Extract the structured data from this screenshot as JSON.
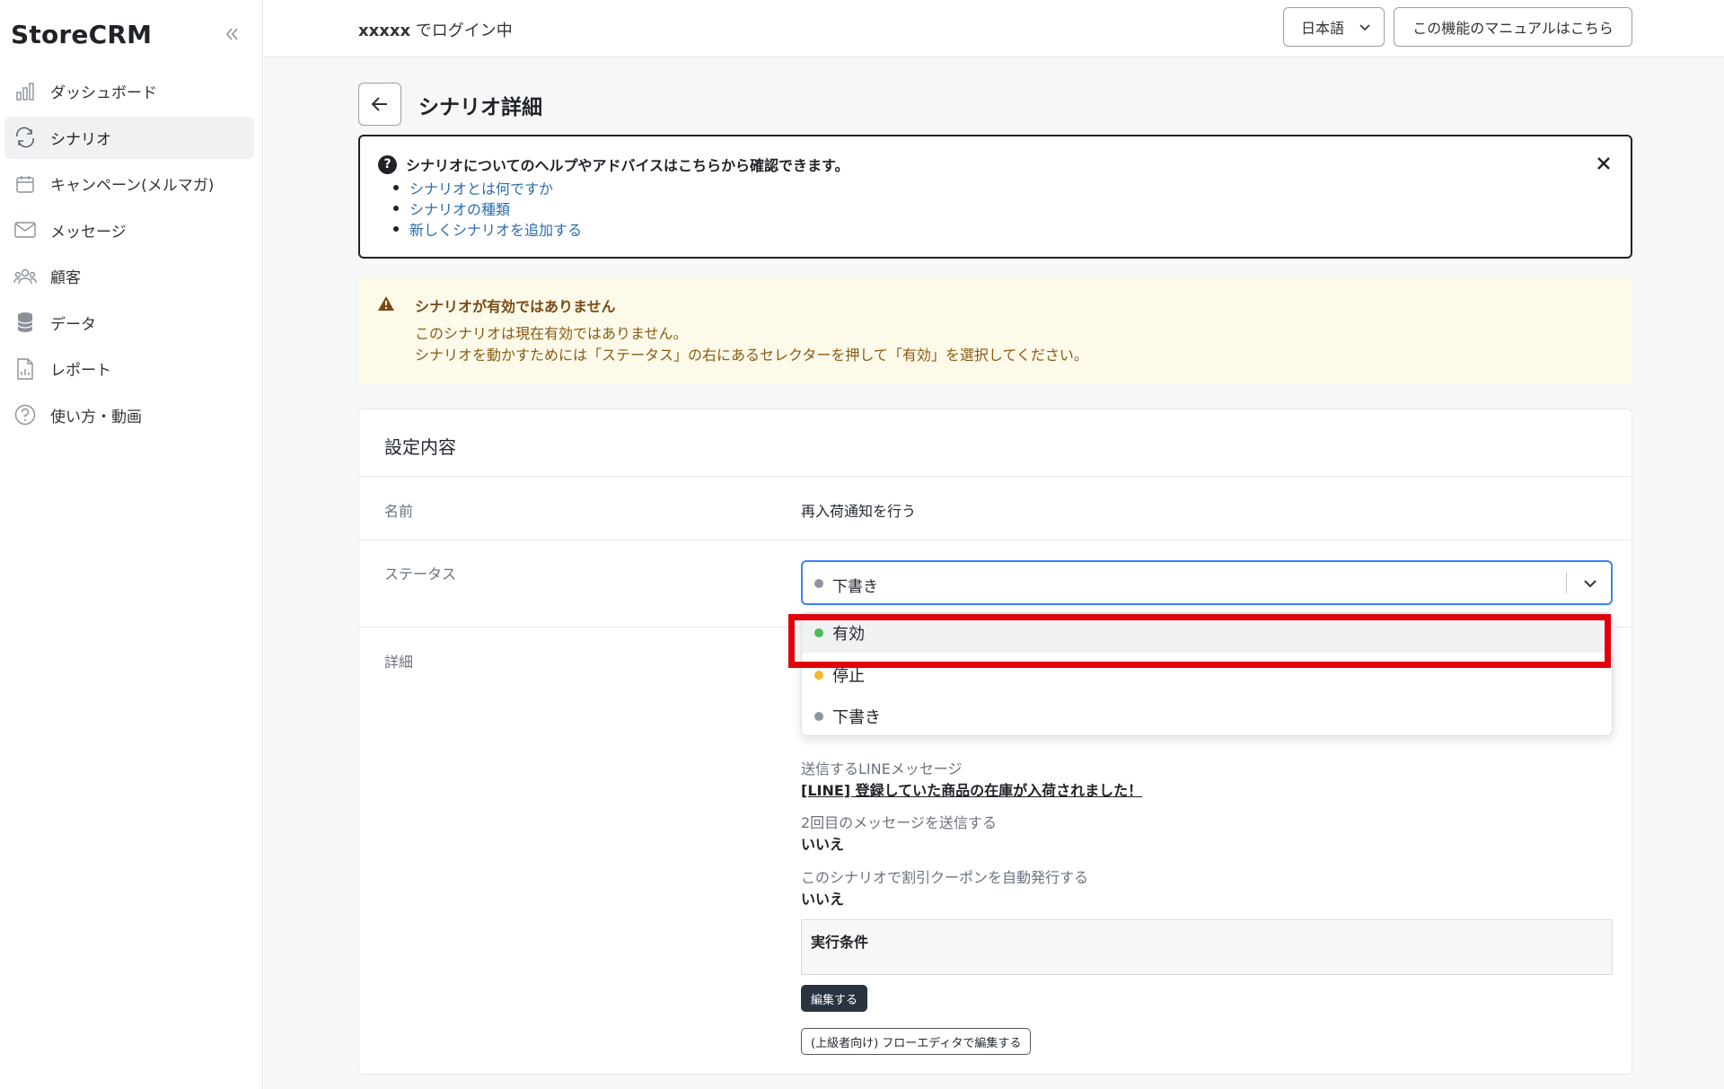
{
  "app": {
    "logo": "StoreCRM"
  },
  "sidebar": {
    "items": [
      {
        "label": "ダッシュボード",
        "icon": "bar-chart-icon"
      },
      {
        "label": "シナリオ",
        "icon": "refresh-icon",
        "active": true
      },
      {
        "label": "キャンペーン(メルマガ)",
        "icon": "calendar-icon"
      },
      {
        "label": "メッセージ",
        "icon": "mail-icon"
      },
      {
        "label": "顧客",
        "icon": "users-icon"
      },
      {
        "label": "データ",
        "icon": "database-icon"
      },
      {
        "label": "レポート",
        "icon": "report-icon"
      },
      {
        "label": "使い方・動画",
        "icon": "help-circle-icon"
      }
    ]
  },
  "header": {
    "login_user": "xxxxx",
    "login_suffix": " でログイン中",
    "language": "日本語",
    "manual_label": "この機能のマニュアルはこちら"
  },
  "page": {
    "title": "シナリオ詳細"
  },
  "help": {
    "title": "シナリオについてのヘルプやアドバイスはこちらから確認できます。",
    "links": [
      "シナリオとは何ですか",
      "シナリオの種類",
      "新しくシナリオを追加する"
    ]
  },
  "warning": {
    "title": "シナリオが有効ではありません",
    "line1": "このシナリオは現在有効ではありません。",
    "line2": "シナリオを動かすためには「ステータス」の右にあるセレクターを押して「有効」を選択してください。"
  },
  "settings": {
    "title": "設定内容",
    "name_label": "名前",
    "name_value": "再入荷通知を行う",
    "status_label": "ステータス",
    "status_value": "下書き",
    "detail_label": "詳細",
    "status_options": [
      {
        "label": "有効",
        "color": "#4cbb5a"
      },
      {
        "label": "停止",
        "color": "#f2b928"
      },
      {
        "label": "下書き",
        "color": "#8e959c"
      }
    ],
    "line_message_label": "送信するLINEメッセージ",
    "line_message_value": "[LINE] 登録していた商品の在庫が入荷されました！",
    "second_message_label": "2回目のメッセージを送信する",
    "second_message_value": "いいえ",
    "coupon_label": "このシナリオで割引クーポンを自動発行する",
    "coupon_value": "いいえ",
    "condition_title": "実行条件",
    "edit_label": "編集する",
    "flow_editor_label": "(上級者向け) フローエディタで編集する"
  },
  "colors": {
    "accent": "#3b82f6",
    "highlight": "#e0000b",
    "warning_bg": "#fdfaea",
    "link": "#2b6cb0"
  }
}
